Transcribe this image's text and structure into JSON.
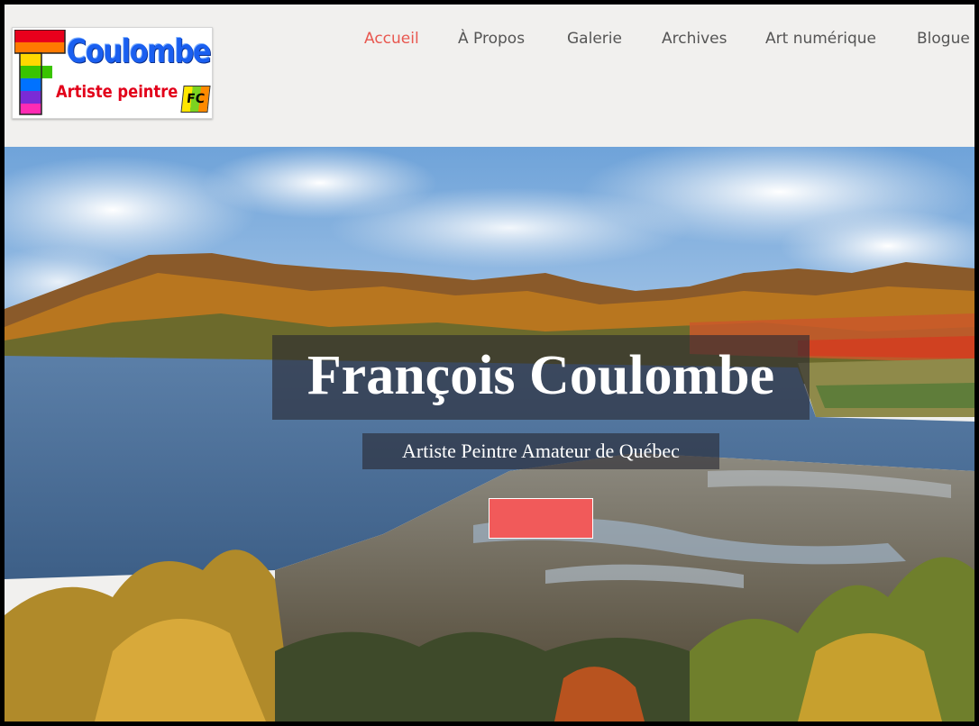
{
  "logo": {
    "name": "Coulombe",
    "subtitle": "Artiste peintre",
    "badge": "FC"
  },
  "nav": {
    "items": [
      "Accueil",
      "À Propos",
      "Galerie",
      "Archives",
      "Art numérique",
      "Blogue"
    ],
    "active_index": 0,
    "active_color": "#e8574f",
    "text_color": "#555555"
  },
  "hero": {
    "title": "François Coulombe",
    "subtitle": "Artiste Peintre Amateur de Québec",
    "cta_color": "#f15a5a",
    "background": "autumn-landscape-river-image"
  },
  "colors": {
    "header_bg": "#f1f0ee"
  }
}
